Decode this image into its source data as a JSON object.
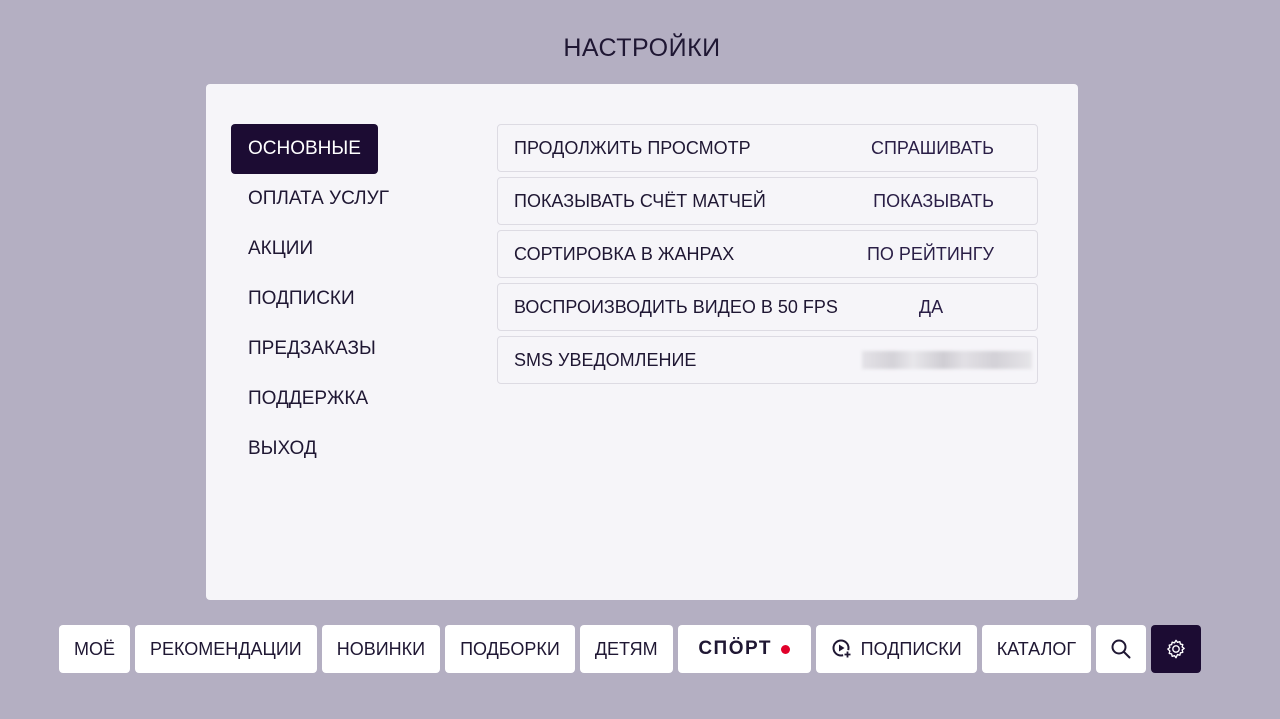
{
  "page": {
    "title": "НАСТРОЙКИ"
  },
  "sidebar": {
    "items": [
      {
        "label": "ОСНОВНЫЕ",
        "active": true
      },
      {
        "label": "ОПЛАТА УСЛУГ"
      },
      {
        "label": "АКЦИИ"
      },
      {
        "label": "ПОДПИСКИ"
      },
      {
        "label": "ПРЕДЗАКАЗЫ"
      },
      {
        "label": "ПОДДЕРЖКА"
      },
      {
        "label": "ВЫХОД"
      }
    ]
  },
  "settings": {
    "rows": [
      {
        "label": "ПРОДОЛЖИТЬ ПРОСМОТР",
        "value": "СПРАШИВАТЬ"
      },
      {
        "label": "ПОКАЗЫВАТЬ СЧЁТ МАТЧЕЙ",
        "value": "ПОКАЗЫВАТЬ"
      },
      {
        "label": "СОРТИРОВКА В ЖАНРАХ",
        "value": "ПО РЕЙТИНГУ"
      },
      {
        "label": "ВОСПРОИЗВОДИТЬ ВИДЕО В 50 FPS",
        "value": "ДА"
      },
      {
        "label": "SMS УВЕДОМЛЕНИЕ",
        "value_hidden": true
      }
    ]
  },
  "nav": {
    "items": [
      {
        "label": "МОЁ"
      },
      {
        "label": "РЕКОМЕНДАЦИИ"
      },
      {
        "label": "НОВИНКИ"
      },
      {
        "label": "ПОДБОРКИ"
      },
      {
        "label": "ДЕТЯМ"
      },
      {
        "label": "СПÖРТ"
      },
      {
        "label": "ПОДПИСКИ",
        "icon": "subscription-play-plus-icon"
      },
      {
        "label": "КАТАЛОГ"
      }
    ],
    "search_icon": "search-icon",
    "settings_icon": "gear-icon"
  },
  "colors": {
    "background": "#b4afc2",
    "panel": "#f6f5f9",
    "accent_dark": "#1c0c33",
    "sport_dot": "#e1002a",
    "arc_purple": "#8a2be2"
  }
}
